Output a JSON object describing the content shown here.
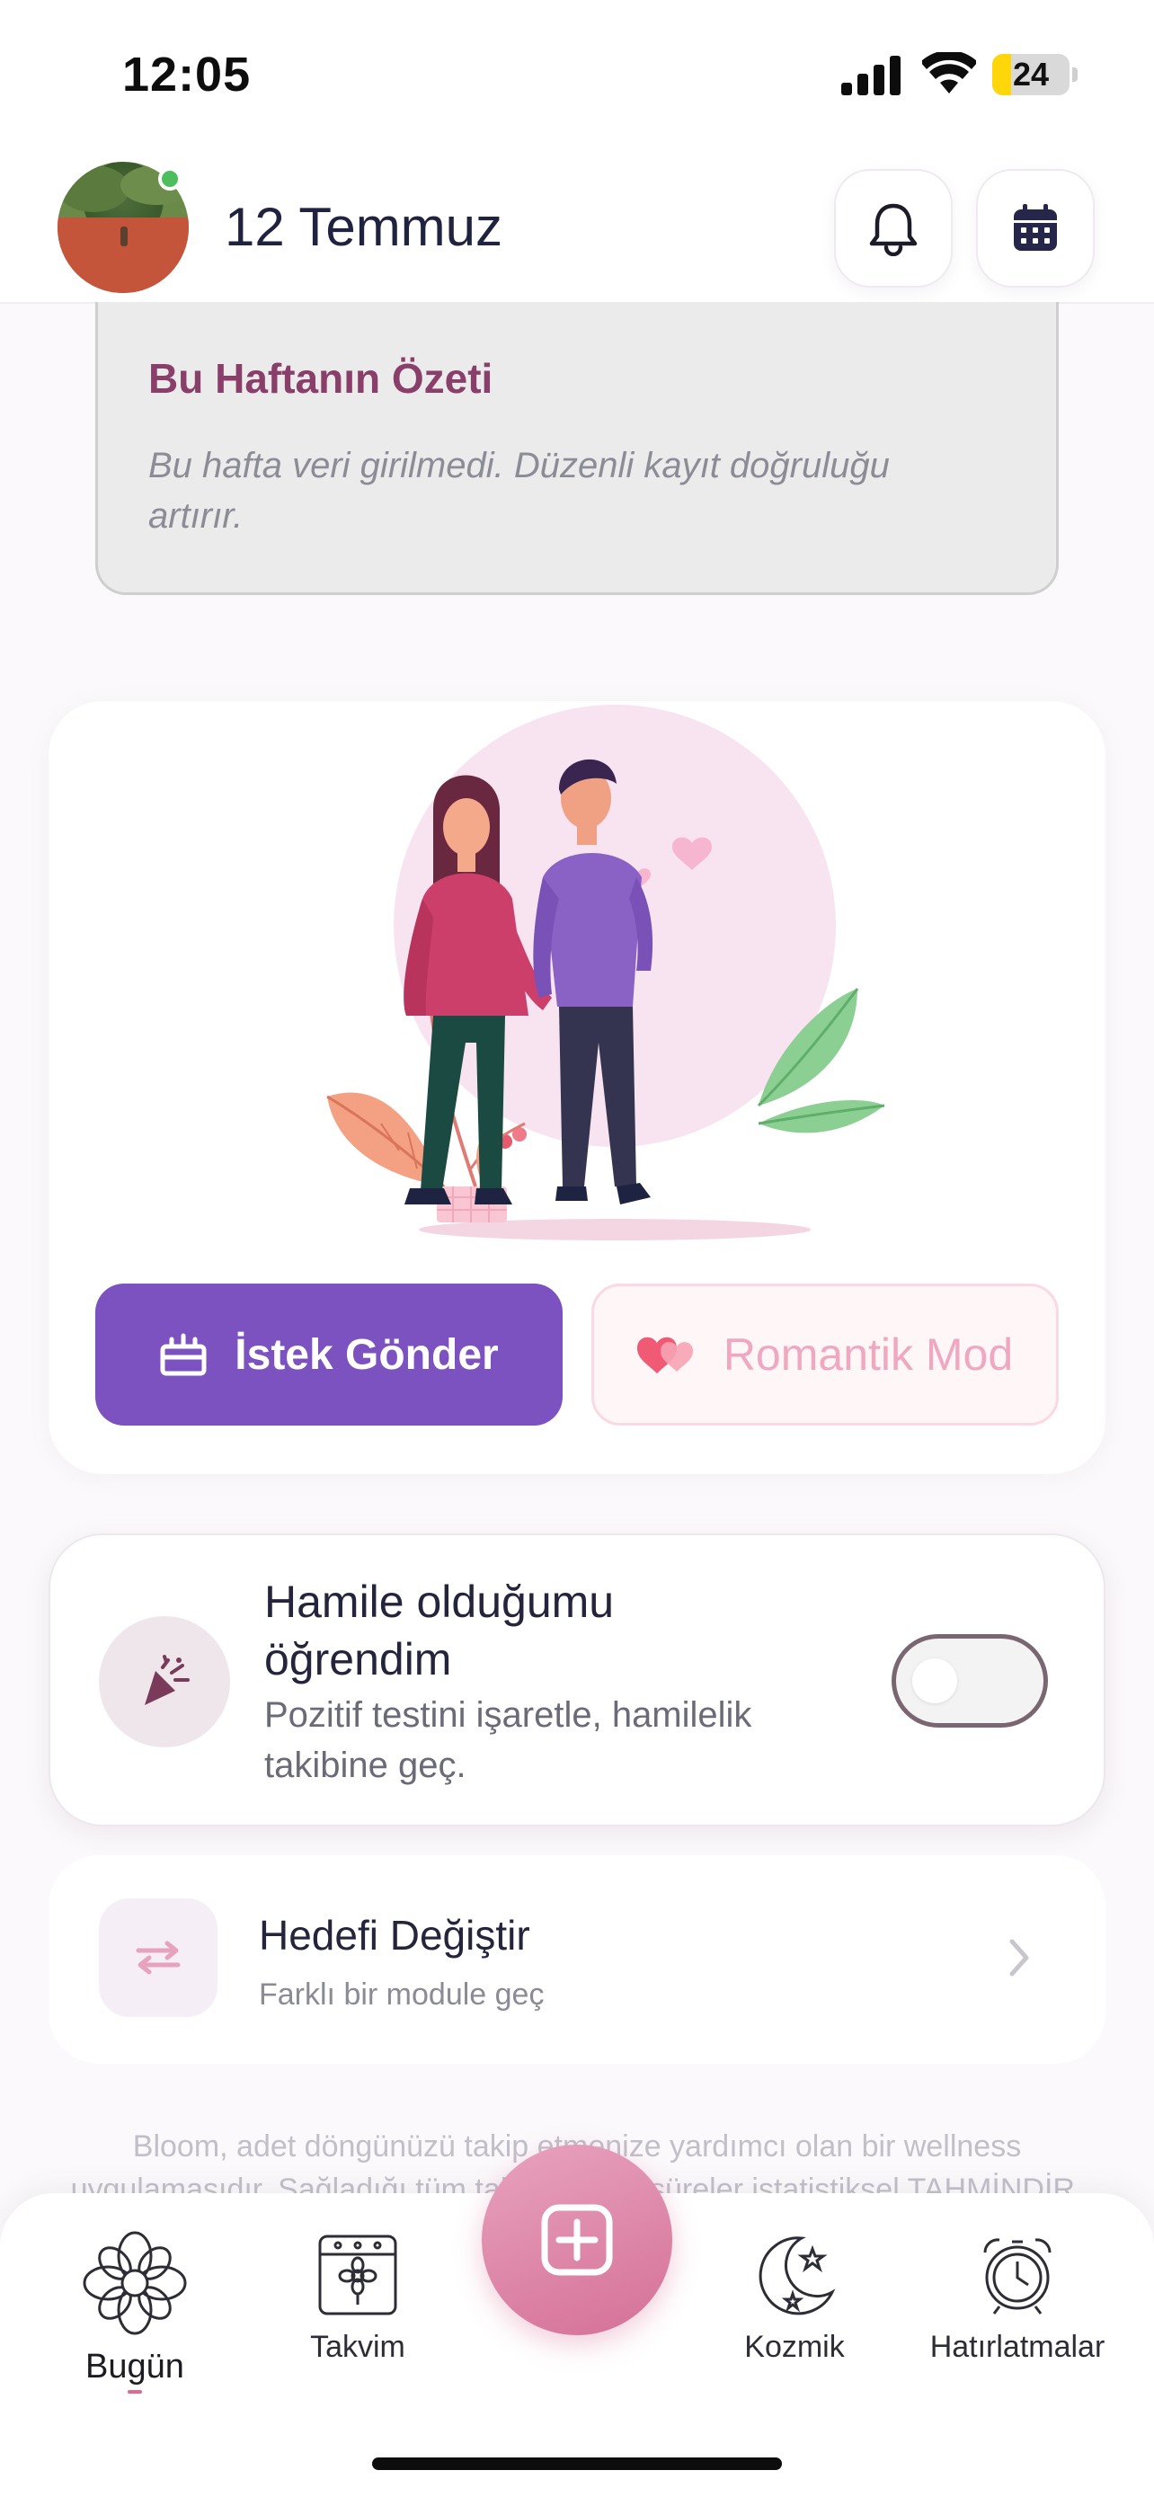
{
  "status_bar": {
    "time": "12:05",
    "battery": "24",
    "battery_level": 0.24
  },
  "header": {
    "title": "12 Temmuz",
    "avatar_icon": "avatar-photo",
    "online_color": "#4cbe5e"
  },
  "summary": {
    "title": "Bu Haftanın Özeti",
    "text": "Bu hafta veri girilmedi. Düzenli kayıt doğruluğu artırır."
  },
  "couple_card": {
    "illustration_icon": "couple-illustration",
    "primary_button": "İstek Gönder",
    "secondary_button": "Romantik Mod",
    "accent_color": "#7b52bf"
  },
  "pregnancy": {
    "title": "Hamile olduğumu öğrendim",
    "subtitle": "Pozitif testini işaretle, hamilelik takibine geç.",
    "toggle_on": false
  },
  "goal": {
    "title": "Hedefi Değiştir",
    "subtitle": "Farklı bir module geç"
  },
  "disclaimer": "Bloom, adet döngünüzü takip etmenize yardımcı olan bir wellness uygulamasıdır. Sağladığı tüm tahminler ve süreler istatistiksel TAHMİNDİR.",
  "tabbar": {
    "tabs": [
      {
        "label": "Bugün",
        "icon": "flower-icon",
        "active": true
      },
      {
        "label": "Takvim",
        "icon": "calendar-flower-icon",
        "active": false
      },
      {
        "label": "Kozmik",
        "icon": "moon-stars-icon",
        "active": false
      },
      {
        "label": "Hatırlatmalar",
        "icon": "alarm-clock-icon",
        "active": false
      }
    ],
    "fab_icon": "add-square-icon",
    "brand_color": "#d57097"
  }
}
